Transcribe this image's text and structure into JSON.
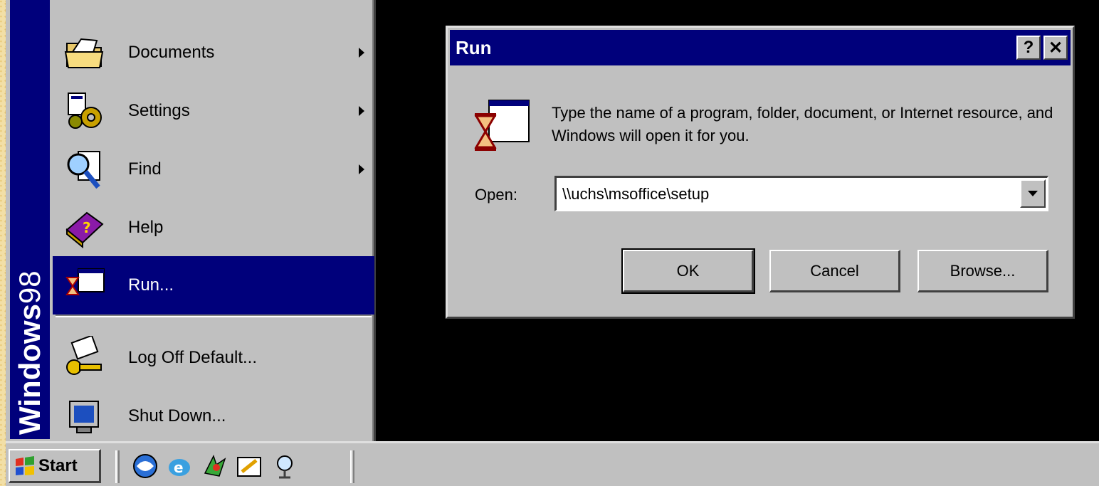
{
  "start_menu": {
    "brand_bold": "Windows",
    "brand_light": "98",
    "items": [
      {
        "label": "Documents",
        "icon": "documents-folder-icon",
        "submenu": true
      },
      {
        "label": "Settings",
        "icon": "settings-icon",
        "submenu": true
      },
      {
        "label": "Find",
        "icon": "find-icon",
        "submenu": true
      },
      {
        "label": "Help",
        "icon": "help-book-icon",
        "submenu": false
      },
      {
        "label": "Run...",
        "icon": "run-icon",
        "submenu": false,
        "selected": true
      },
      {
        "label": "Log Off Default...",
        "icon": "log-off-key-icon",
        "submenu": false
      },
      {
        "label": "Shut Down...",
        "icon": "shut-down-icon",
        "submenu": false
      }
    ]
  },
  "dialog": {
    "title": "Run",
    "help_label": "?",
    "close_label": "✕",
    "description": "Type the name of a program, folder, document, or Internet resource, and Windows will open it for you.",
    "open_label": "Open:",
    "open_value": "\\\\uchs\\msoffice\\setup",
    "ok_label": "OK",
    "cancel_label": "Cancel",
    "browse_label": "Browse..."
  },
  "taskbar": {
    "start_label": "Start",
    "quick_launch": [
      "internet-explorer-icon",
      "outlook-express-icon",
      "channels-icon",
      "show-desktop-icon",
      "view-channels-icon"
    ]
  },
  "colors": {
    "titlebar": "#00007b",
    "face": "#c0c0c0",
    "selection": "#00007b",
    "desktop": "#000000",
    "frame": "#f2dfa6"
  }
}
